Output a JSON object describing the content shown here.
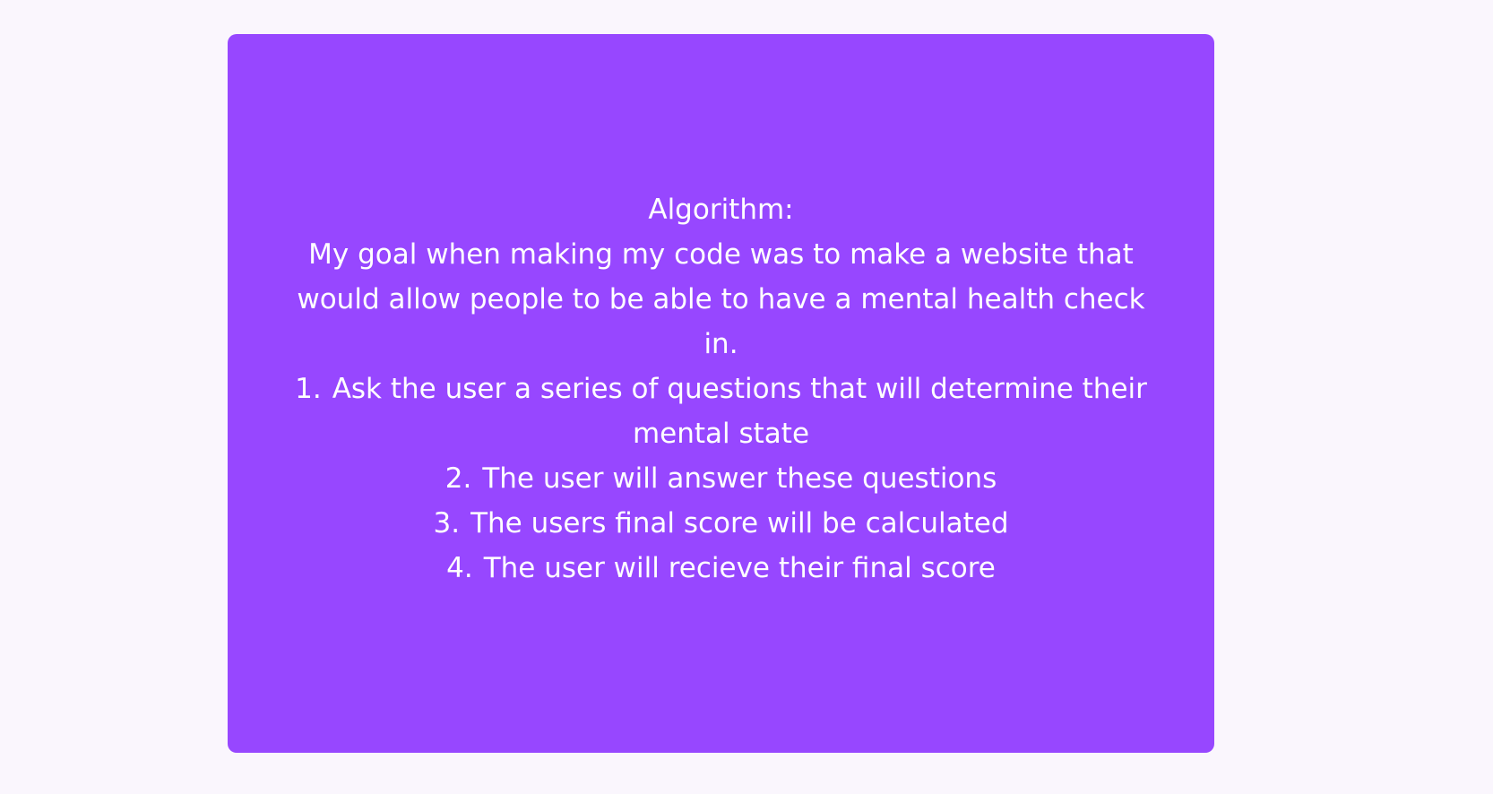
{
  "card": {
    "background": "#9747ff",
    "heading": "Algorithm:",
    "intro": "My goal when making my code was to make a website that would allow people to be able to have a mental health check in.",
    "steps": [
      {
        "number": "1.",
        "text": "Ask the user a series of questions that will determine their mental state"
      },
      {
        "number": "2.",
        "text": "The user will answer these questions"
      },
      {
        "number": "3.",
        "text": "The users final score will be calculated"
      },
      {
        "number": "4.",
        "text": "The user will recieve their final score"
      }
    ]
  }
}
